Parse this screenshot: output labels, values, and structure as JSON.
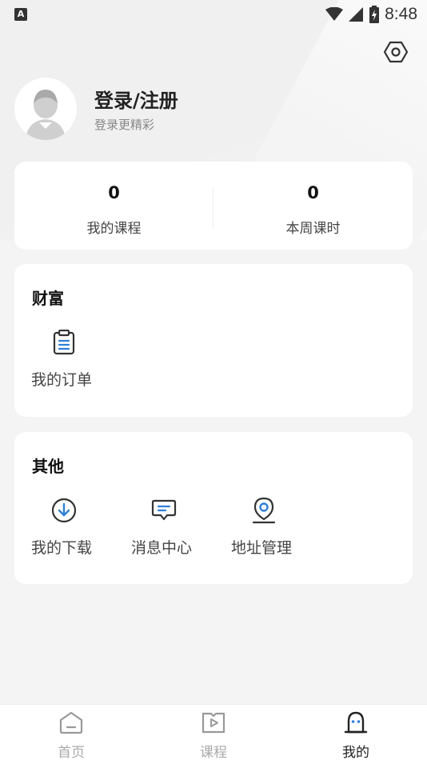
{
  "status_bar": {
    "left_badge": "A",
    "time": "8:48"
  },
  "profile": {
    "title": "登录/注册",
    "subtitle": "登录更精彩"
  },
  "stats": [
    {
      "value": "0",
      "label": "我的课程"
    },
    {
      "value": "0",
      "label": "本周课时"
    }
  ],
  "wealth": {
    "title": "财富",
    "items": [
      {
        "label": "我的订单",
        "icon": "order-clipboard-icon"
      }
    ]
  },
  "other": {
    "title": "其他",
    "items": [
      {
        "label": "我的下载",
        "icon": "download-icon"
      },
      {
        "label": "消息中心",
        "icon": "message-icon"
      },
      {
        "label": "地址管理",
        "icon": "location-pin-icon"
      }
    ]
  },
  "tabbar": {
    "items": [
      {
        "label": "首页",
        "icon": "home-icon",
        "active": false
      },
      {
        "label": "课程",
        "icon": "course-play-icon",
        "active": false
      },
      {
        "label": "我的",
        "icon": "profile-icon",
        "active": true
      }
    ]
  },
  "colors": {
    "accent_blue": "#2f7fd6",
    "text_dark": "#222222",
    "text_muted": "#888888",
    "tab_inactive": "#aaaaaa"
  }
}
